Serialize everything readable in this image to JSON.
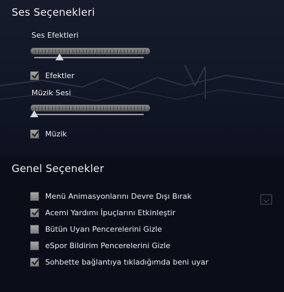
{
  "sound_options": {
    "title": "Ses Seçenekleri",
    "effects_volume": {
      "label": "Ses Efektleri",
      "level": 0.23
    },
    "effects_toggle": {
      "label": "Efektler",
      "checked": true
    },
    "music_volume": {
      "label": "Müzik Sesi",
      "level": 0.0
    },
    "music_toggle": {
      "label": "Müzik",
      "checked": true
    }
  },
  "general_options": {
    "title": "Genel Seçenekler",
    "items": [
      {
        "label": "Menü Animasyonlarını Devre Dışı Bırak",
        "checked": false
      },
      {
        "label": "Acemi Yardımı İpuçlarını Etkinleştir",
        "checked": true
      },
      {
        "label": "Bütün Uyarı Pencerelerini Gizle",
        "checked": false
      },
      {
        "label": "eSpor Bildirim Pencerelerini Gizle",
        "checked": false
      },
      {
        "label": "Sohbette bağlantıya tıkladığımda beni uyar",
        "checked": true
      }
    ]
  },
  "colors": {
    "background": "#0b0e19",
    "panel": "#141a2a",
    "checkbox": "#8e8e8e",
    "text": "#ececec"
  }
}
